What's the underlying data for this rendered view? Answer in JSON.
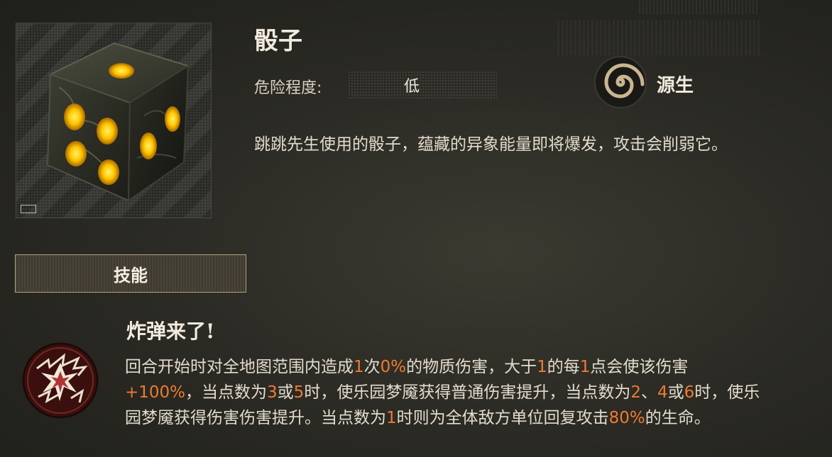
{
  "item": {
    "name": "骰子",
    "danger_label": "危险程度:",
    "danger_value": "低",
    "type_label": "源生",
    "type_icon": "spiral-icon",
    "description": "跳跳先生使用的骰子，蕴藏的异象能量即将爆发，攻击会削弱它。",
    "portrait_icon": "glowing-dice"
  },
  "tabs": {
    "skill_label": "技能"
  },
  "skill": {
    "icon": "explosion-icon",
    "name": "炸弹来了!",
    "desc": [
      {
        "t": "回合开始时对全地图范围内造成",
        "h": false
      },
      {
        "t": "1",
        "h": true
      },
      {
        "t": "次",
        "h": false
      },
      {
        "t": "0%",
        "h": true
      },
      {
        "t": "的物质伤害，大于",
        "h": false
      },
      {
        "t": "1",
        "h": true
      },
      {
        "t": "的每",
        "h": false
      },
      {
        "t": "1",
        "h": true
      },
      {
        "t": "点会使该伤害",
        "h": false
      },
      {
        "t": "+100%",
        "h": true
      },
      {
        "t": "，当点数为",
        "h": false
      },
      {
        "t": "3",
        "h": true
      },
      {
        "t": "或",
        "h": false
      },
      {
        "t": "5",
        "h": true
      },
      {
        "t": "时，使乐园梦魇获得普通伤害提升，当点数为",
        "h": false
      },
      {
        "t": "2",
        "h": true
      },
      {
        "t": "、",
        "h": false
      },
      {
        "t": "4",
        "h": true
      },
      {
        "t": "或",
        "h": false
      },
      {
        "t": "6",
        "h": true
      },
      {
        "t": "时，使乐园梦魇获得伤害伤害提升。当点数为",
        "h": false
      },
      {
        "t": "1",
        "h": true
      },
      {
        "t": "时则为全体敌方单位回复攻击",
        "h": false
      },
      {
        "t": "80%",
        "h": true
      },
      {
        "t": "的生命。",
        "h": false
      }
    ]
  },
  "colors": {
    "highlight": "#ee7a32",
    "accent_border": "#b3a37b"
  }
}
